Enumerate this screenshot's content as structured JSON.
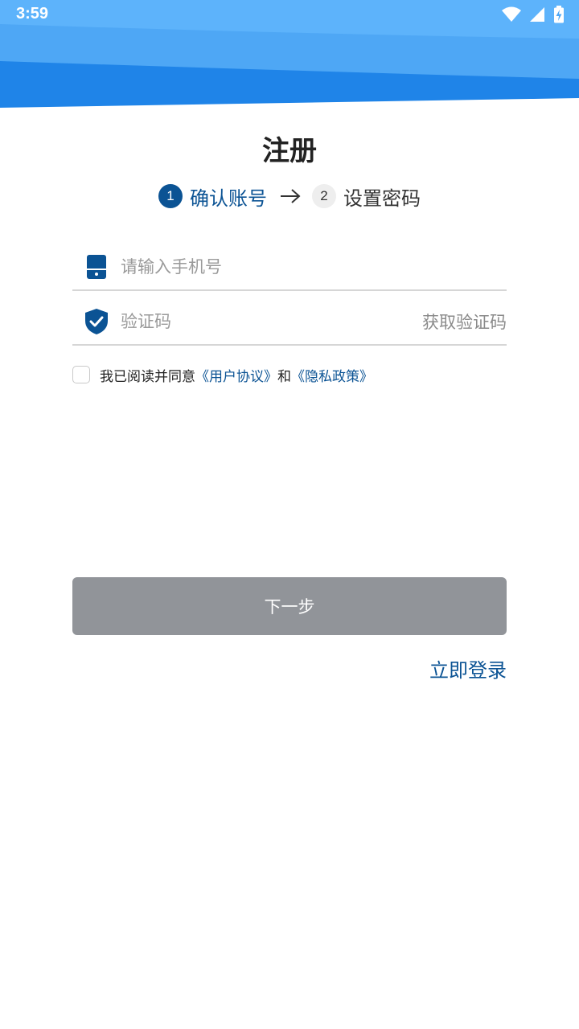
{
  "status_bar": {
    "time": "3:59",
    "icons": [
      "wifi-icon",
      "signal-icon",
      "battery-charging-icon"
    ]
  },
  "title": "注册",
  "steps": [
    {
      "number": "1",
      "label": "确认账号",
      "state": "active"
    },
    {
      "number": "2",
      "label": "设置密码",
      "state": "inactive"
    }
  ],
  "phone": {
    "placeholder": "请输入手机号",
    "value": "",
    "icon": "phone-icon"
  },
  "verify": {
    "placeholder": "验证码",
    "value": "",
    "icon": "shield-check-icon",
    "get_code_label": "获取验证码"
  },
  "agreement": {
    "checked": false,
    "prefix": "我已阅读并同意",
    "user_agreement": "《用户协议》",
    "conjunction": "和",
    "privacy_policy": "《隐私政策》"
  },
  "next_button": "下一步",
  "login_link": "立即登录",
  "colors": {
    "accent": "#0b5394",
    "header_light": "#4aa8f5",
    "header_dark": "#1a80e6",
    "button_disabled": "#919499"
  }
}
